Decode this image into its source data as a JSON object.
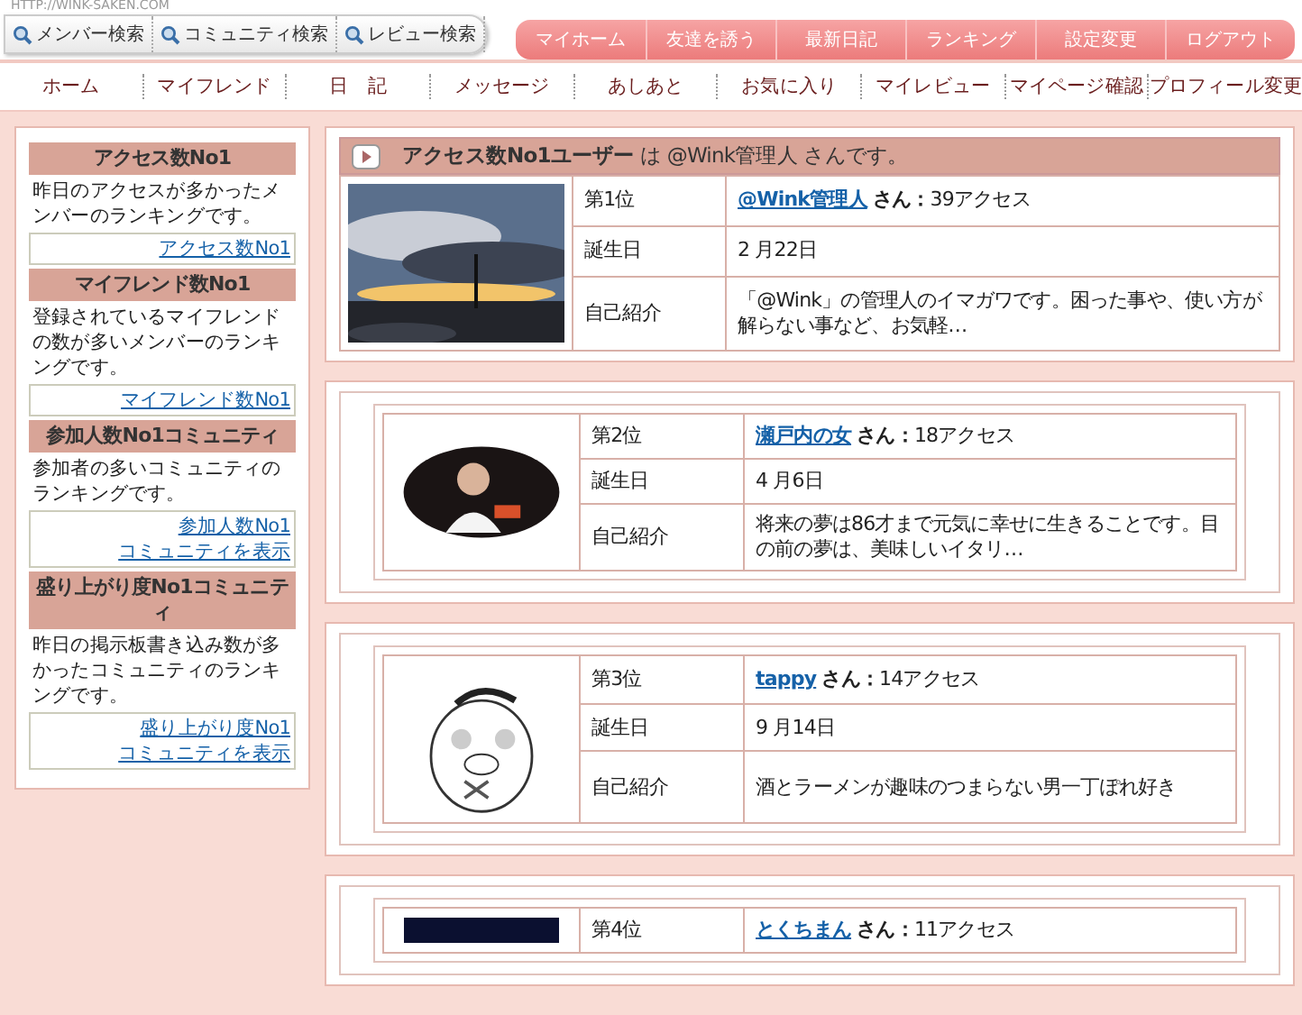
{
  "site_url": "HTTP://WINK-SAKEN.COM",
  "search_buttons": [
    "メンバー検索",
    "コミュニティ検索",
    "レビュー検索"
  ],
  "top_menu": [
    "マイホーム",
    "友達を誘う",
    "最新日記",
    "ランキング",
    "設定変更",
    "ログアウト"
  ],
  "nav": [
    "ホーム",
    "マイフレンド",
    "日　記",
    "メッセージ",
    "あしあと",
    "お気に入り",
    "マイレビュー",
    "マイページ確認",
    "プロフィール変更"
  ],
  "sidebar": [
    {
      "title": "アクセス数No1",
      "text": "昨日のアクセスが多かったメンバーのランキングです。",
      "links": [
        "アクセス数No1"
      ]
    },
    {
      "title": "マイフレンド数No1",
      "text": "登録されているマイフレンドの数が多いメンバーのランキングです。",
      "links": [
        "マイフレンド数No1"
      ]
    },
    {
      "title": "参加人数No1コミュニティ",
      "text": "参加者の多いコミュニティのランキングです。",
      "links": [
        "参加人数No1",
        "コミュニティを表示"
      ]
    },
    {
      "title": "盛り上がり度No1コミュニティ",
      "text": "昨日の掲示板書き込み数が多かったコミュニティのランキングです。",
      "links": [
        "盛り上がり度No1",
        "コミュニティを表示"
      ]
    }
  ],
  "top_user": {
    "heading": "**アクセス数No1ユーザー** は @Wink管理人 さんです。"
  },
  "rankings": [
    {
      "photo": {
        "kind": "picture"
      },
      "rows": [
        {
          "kind": "rank",
          "label": "第1位",
          "name": "@Wink管理人",
          "honorific": "さん：",
          "count": "39アクセス"
        },
        {
          "kind": "text",
          "label": "誕生日",
          "value": "2 月22日"
        },
        {
          "kind": "text",
          "label": "自己紹介",
          "value": "「@Wink」の管理人のイマガワです。困った事や、使い方が解らない事など、お気軽…"
        }
      ]
    },
    {
      "photo": {
        "kind": "picture"
      },
      "rows": [
        {
          "kind": "rank",
          "label": "第2位",
          "name": "瀬戸内の女",
          "honorific": "さん：",
          "count": "18アクセス"
        },
        {
          "kind": "text",
          "label": "誕生日",
          "value": "4 月6日"
        },
        {
          "kind": "text",
          "label": "自己紹介",
          "value": "将来の夢は86才まで元気に幸せに生きることです。目の前の夢は、美味しいイタリ…"
        }
      ]
    },
    {
      "photo": {
        "kind": "picture"
      },
      "rows": [
        {
          "kind": "rank",
          "label": "第3位",
          "name": "tappy",
          "honorific": "さん：",
          "count": "14アクセス"
        },
        {
          "kind": "text",
          "label": "誕生日",
          "value": "9 月14日"
        },
        {
          "kind": "text",
          "label": "自己紹介",
          "value": "酒とラーメンが趣味のつまらない男一丁ぽれ好き"
        }
      ]
    },
    {
      "photo": {
        "kind": "picture"
      },
      "rows": [
        {
          "kind": "rank",
          "label": "第4位",
          "name": "とくちまん",
          "honorific": "さん：",
          "count": "11アクセス"
        }
      ]
    }
  ]
}
